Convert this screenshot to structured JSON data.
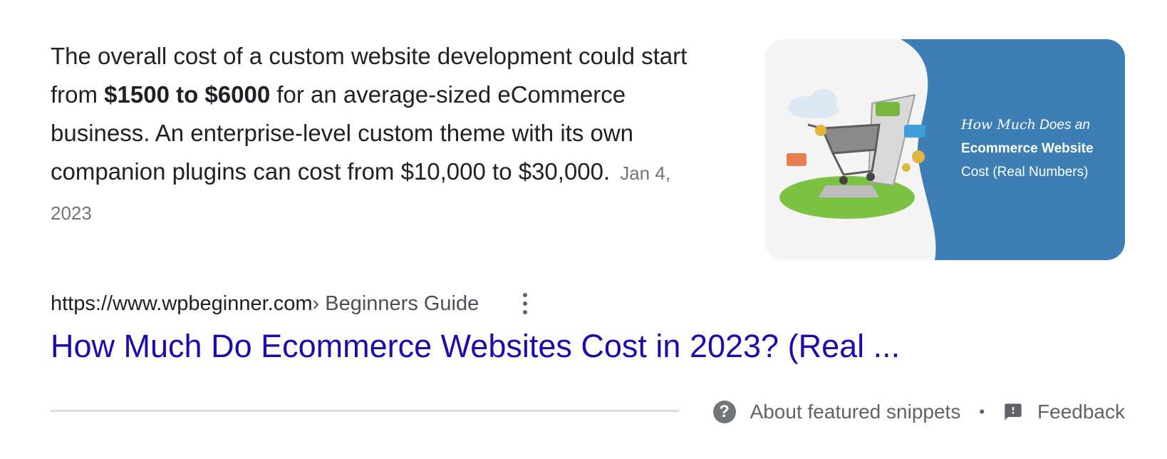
{
  "snippet": {
    "text_part1": "The overall cost of a custom website development could start from ",
    "text_bold": "$1500 to $6000",
    "text_part2": " for an average-sized eCommerce business. An enterprise-level custom theme with its own companion plugins can cost from $10,000 to $30,000.",
    "date": "Jan 4, 2023"
  },
  "thumbnail": {
    "caption_line1_emph": "How Much",
    "caption_line1_rest": " Does an",
    "caption_line2": "Ecommerce Website",
    "caption_line3": "Cost (Real Numbers)",
    "icon": "shopping-cart-laptop-illustration",
    "colors": {
      "panel_blue": "#3d7fb5",
      "grass_green": "#7cc242",
      "bubble_green": "#76b83f",
      "bubble_blue": "#3e9ed9",
      "coin_gold": "#e2b53c"
    }
  },
  "result": {
    "domain": "https://www.wpbeginner.com",
    "breadcrumb": " › Beginners Guide",
    "title": "How Much Do Ecommerce Websites Cost in 2023? (Real ...",
    "menu_icon": "more-vert-icon"
  },
  "footer": {
    "about_label": "About featured snippets",
    "separator": "•",
    "feedback_label": "Feedback",
    "about_icon": "help-circle-icon",
    "feedback_icon": "feedback-icon"
  },
  "colors": {
    "link": "#1a0dab",
    "text": "#202124",
    "muted": "#70757a"
  }
}
